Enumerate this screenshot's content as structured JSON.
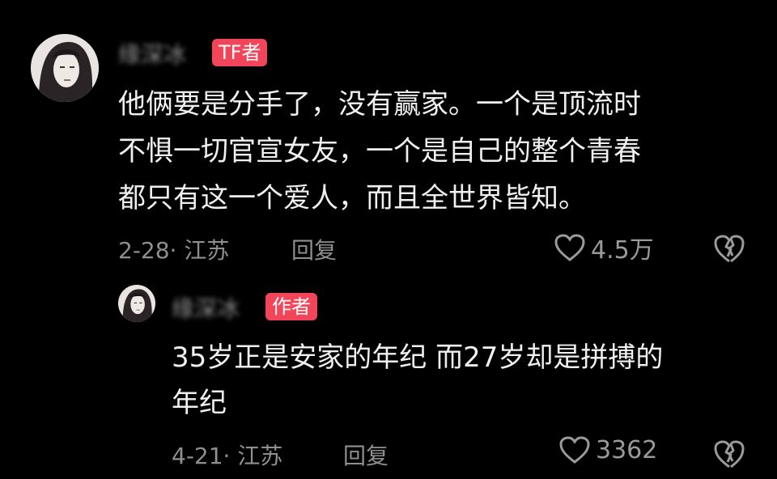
{
  "comments": [
    {
      "username": "缘深冰",
      "badge": "TF者",
      "text": "他俩要是分手了，没有赢家。一个是顶流时\n不惧一切官宣女友，一个是自己的整个青春\n都只有这一个爱人，而且全世界皆知。",
      "date_location": "2-28· 江苏",
      "reply_label": "回复",
      "likes": "4.5万",
      "like_icon": "heart-outline",
      "dislike_icon": "broken-heart"
    },
    {
      "username": "缘深冰",
      "badge": "作者",
      "text": "35岁正是安家的年纪 而27岁却是拼搏的\n年纪",
      "date_location": "4-21· 江苏",
      "reply_label": "回复",
      "likes": "3362",
      "like_icon": "heart-outline",
      "dislike_icon": "broken-heart"
    }
  ],
  "colors": {
    "background": "#000000",
    "badge": "#f2455a",
    "meta": "#8f8f8f",
    "text": "#f0f0f0"
  }
}
